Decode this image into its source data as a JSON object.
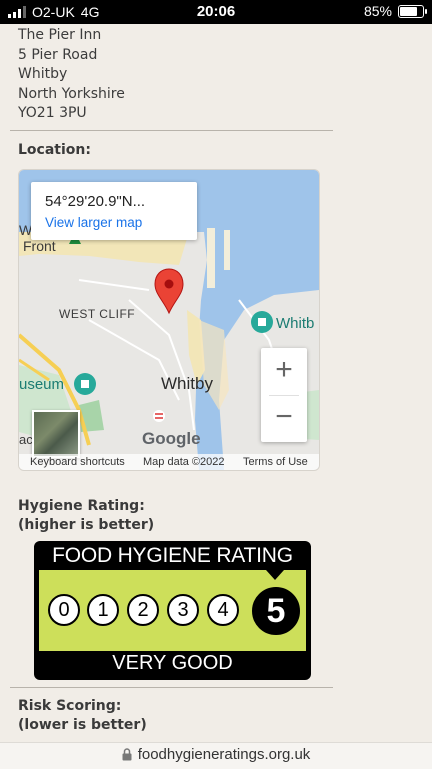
{
  "status_bar": {
    "carrier": "O2-UK",
    "network": "4G",
    "time": "20:06",
    "battery": "85%",
    "battery_level": 0.85
  },
  "address": {
    "lines": [
      "The Pier Inn",
      "5 Pier Road",
      "Whitby",
      "North Yorkshire",
      "YO21 3PU"
    ]
  },
  "location": {
    "heading": "Location:",
    "map": {
      "coords": "54°29'20.9\"N...",
      "view_larger": "View larger map",
      "labels": {
        "front": "Front",
        "west_cliff": "WEST CLIFF",
        "whitby": "Whitby",
        "whitb_poi": "Whitb",
        "museum": "useum",
        "google": "Google",
        "edge_wh": "Wh",
        "edge_ac": "ac"
      },
      "zoom_in": "+",
      "zoom_out": "−",
      "footer": {
        "keyboard": "Keyboard shortcuts",
        "map_data": "Map data ©2022",
        "terms": "Terms of Use"
      }
    }
  },
  "hygiene": {
    "heading_line1": "Hygiene Rating:",
    "heading_line2": "(higher is better)",
    "badge": {
      "title": "FOOD HYGIENE RATING",
      "scale": [
        "0",
        "1",
        "2",
        "3",
        "4"
      ],
      "rating": "5",
      "verdict": "VERY GOOD",
      "panel_color": "#cddf5a"
    }
  },
  "risk": {
    "heading_line1": "Risk Scoring:",
    "heading_line2": "(lower is better)"
  },
  "url_bar": {
    "url": "foodhygieneratings.org.uk",
    "icon": "lock-icon"
  }
}
